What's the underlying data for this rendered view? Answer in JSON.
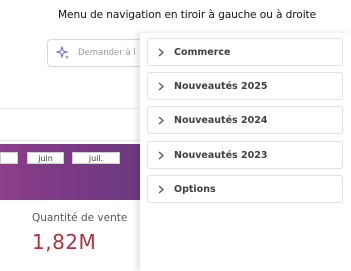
{
  "caption": "Menu de navigation en tiroir à gauche ou à droite",
  "background_app": {
    "ask_placeholder": "Demander à l",
    "timeline_months": {
      "left_fragment": "",
      "juin": "juin",
      "juil": "juil."
    },
    "kpi": {
      "label": "Quantité de vente",
      "value": "1,82M"
    }
  },
  "drawer": {
    "items": [
      {
        "label": "Commerce"
      },
      {
        "label": "Nouveautés 2025"
      },
      {
        "label": "Nouveautés 2024"
      },
      {
        "label": "Nouveautés 2023"
      },
      {
        "label": "Options"
      }
    ]
  },
  "colors": {
    "kpi_value": "#b1323f",
    "timeline_band": "#7d3a86",
    "sparkle_icon": "#7b5cc4"
  }
}
